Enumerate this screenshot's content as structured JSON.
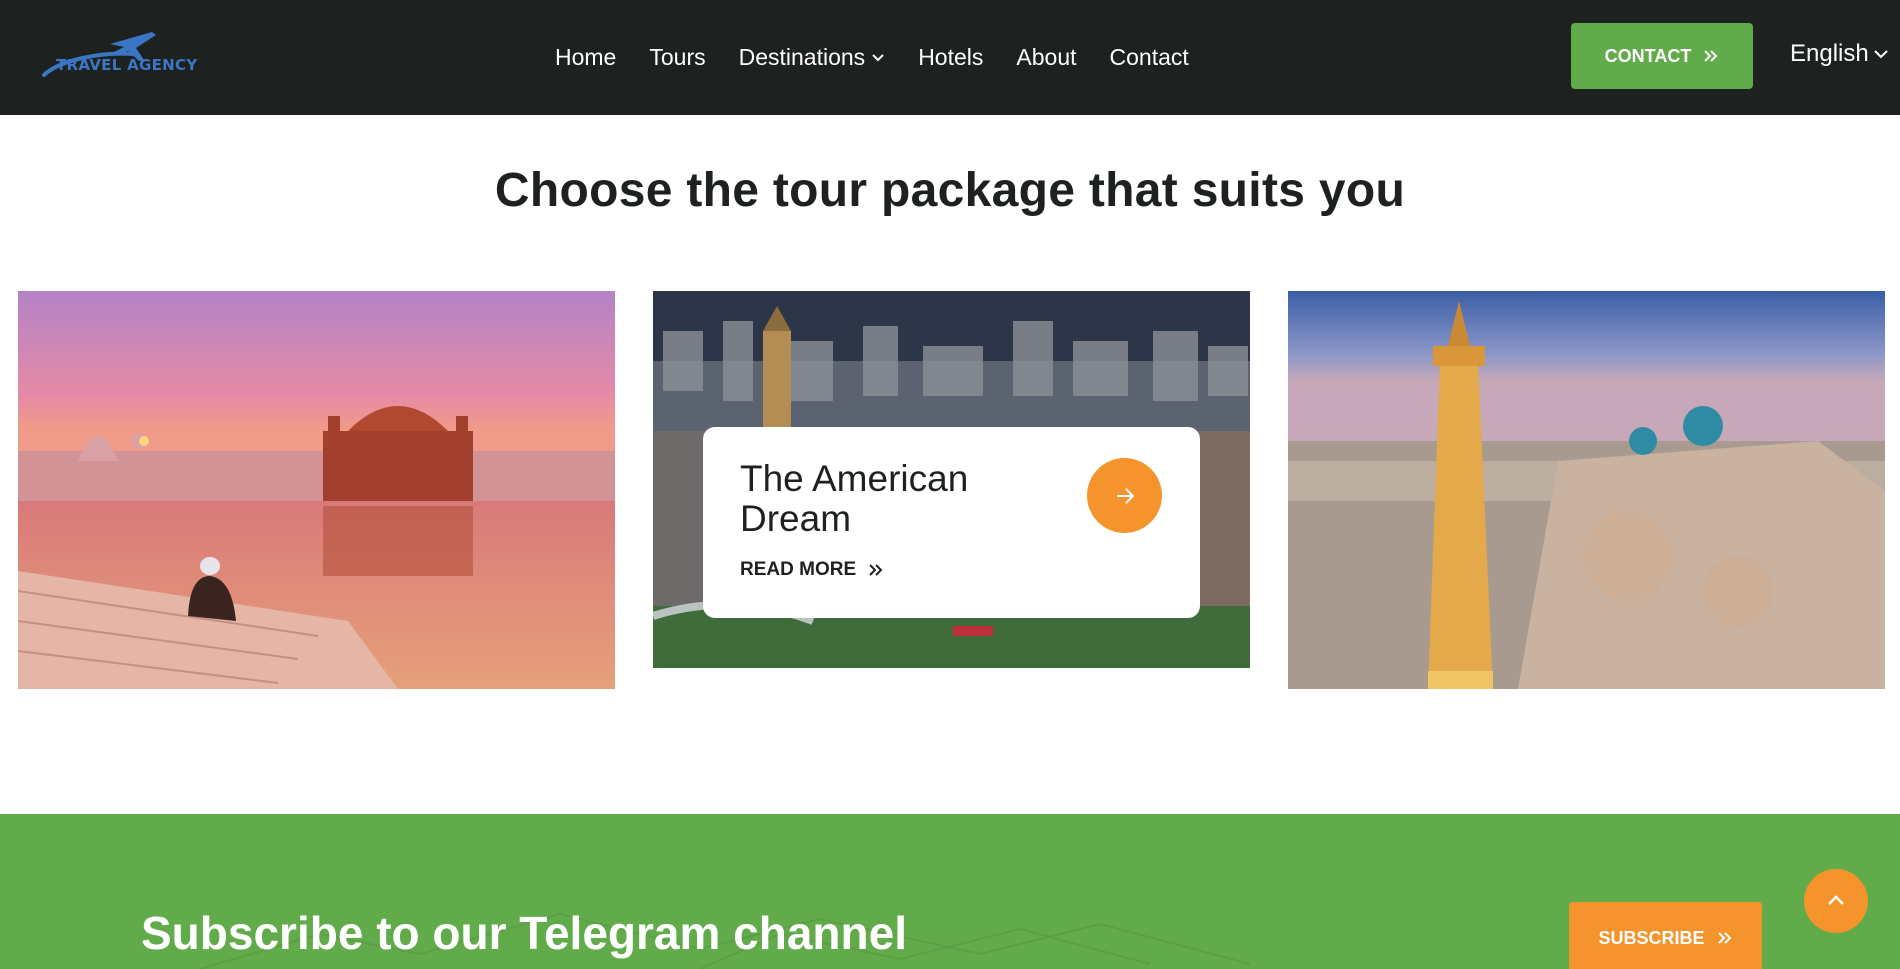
{
  "header": {
    "logo_text": "TRAVEL AGENCY",
    "nav": [
      {
        "label": "Home"
      },
      {
        "label": "Tours"
      },
      {
        "label": "Destinations"
      },
      {
        "label": "Hotels"
      },
      {
        "label": "About"
      },
      {
        "label": "Contact"
      }
    ],
    "contact_label": "CONTACT",
    "language": "English"
  },
  "section": {
    "title": "Choose the tour package that suits you"
  },
  "cards": [
    {
      "image": "golden-temple-amritsar"
    },
    {
      "image": "london-aerial",
      "title": "The American Dream",
      "read_more": "READ MORE"
    },
    {
      "image": "bukhara-kalyan-minaret"
    }
  ],
  "subscribe": {
    "title": "Subscribe to our Telegram channel",
    "button_label": "SUBSCRIBE"
  },
  "icons": [
    "plane-logo-icon",
    "chevron-down-icon",
    "double-chevron-right-icon",
    "arrow-right-icon",
    "chevron-up-icon"
  ],
  "colors": {
    "header_bg": "#1d211f",
    "green": "#62ab4b",
    "orange": "#f5932c",
    "text_dark": "#1d211f",
    "logo_blue": "#3a76c4"
  }
}
